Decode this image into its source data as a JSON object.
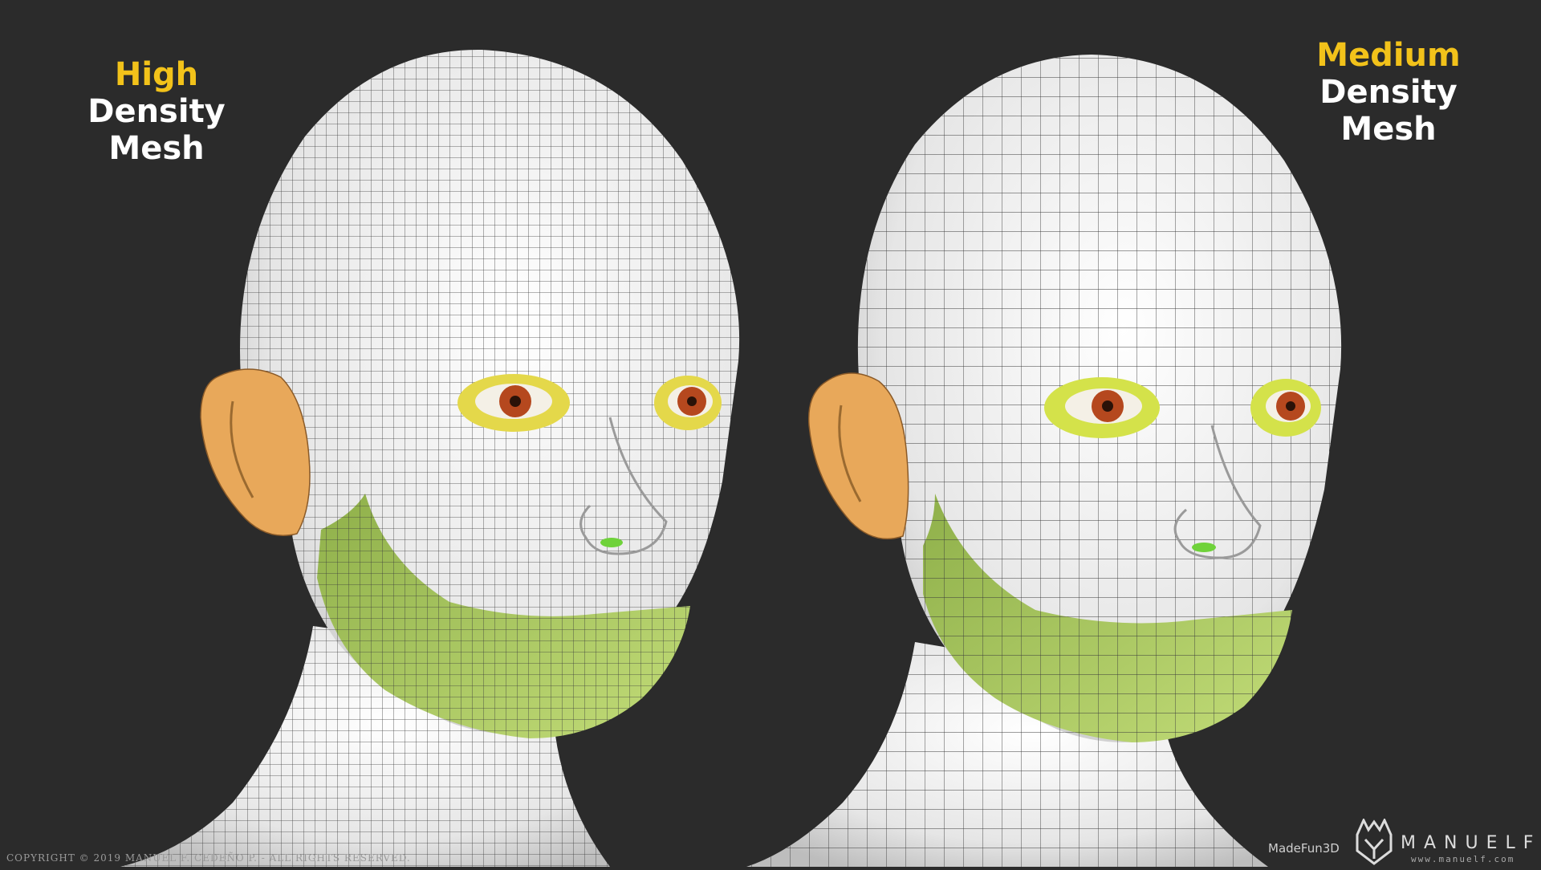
{
  "left_label": {
    "accent": "High",
    "main": "Density Mesh"
  },
  "right_label": {
    "accent": "Medium",
    "main": "Density Mesh"
  },
  "copyright": "COPYRIGHT © 2019 MANUEL F. CEDEÑO P. - ALL RIGHTS RESERVED.",
  "brand": {
    "madefun": "MadeFun3D",
    "name": "MANUELF",
    "site": "www.manuelf.com"
  },
  "colors": {
    "background": "#2b2b2b",
    "accent_text": "#f2c21a",
    "skin_mesh": "#f2f2f2",
    "ear": "#e8a85a",
    "jaw_region": "#a8c45a",
    "eye_ring": "#e4d84a",
    "iris": "#b5481e",
    "shoulder": "#c85a5a"
  },
  "icons": [
    "manuelf-logo-icon"
  ]
}
